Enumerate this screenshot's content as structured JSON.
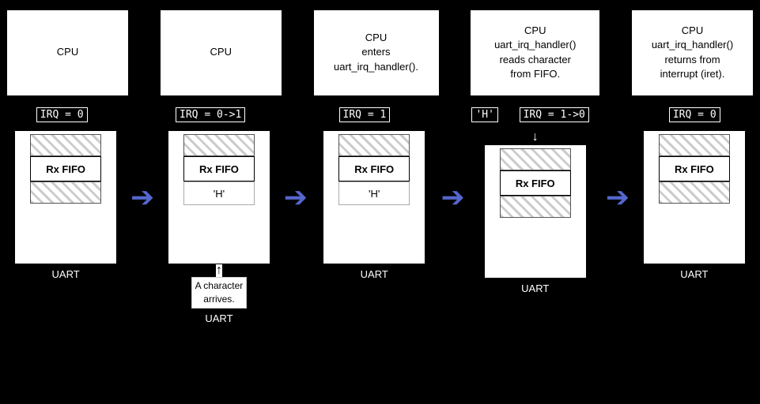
{
  "colors": {
    "background": "#000000",
    "box_bg": "#ffffff",
    "box_border": "#000000",
    "arrow_color": "#5566cc",
    "text_white": "#ffffff",
    "text_black": "#000000",
    "hatch_line": "#cccccc"
  },
  "cpu_boxes": [
    {
      "id": "cpu1",
      "text": "CPU"
    },
    {
      "id": "cpu2",
      "text": "CPU"
    },
    {
      "id": "cpu3",
      "text": "CPU\nenters\nuart_irq_handler()."
    },
    {
      "id": "cpu4",
      "text": "CPU\nuart_irq_handler()\nreads character\nfrom FIFO."
    },
    {
      "id": "cpu5",
      "text": "CPU\nuart_irq_handler()\nreturns from\ninterrupt (iret)."
    }
  ],
  "irq_labels": [
    {
      "id": "irq1",
      "text": "IRQ = 0"
    },
    {
      "id": "irq2",
      "text": "IRQ = 0->1"
    },
    {
      "id": "irq3",
      "text": "IRQ = 1"
    },
    {
      "id": "irq_h",
      "text": "'H'"
    },
    {
      "id": "irq4",
      "text": "IRQ = 1->0"
    },
    {
      "id": "irq5",
      "text": "IRQ = 0"
    }
  ],
  "uart_boxes": [
    {
      "id": "uart1",
      "show_char": false,
      "char": "",
      "label": "UART",
      "has_down_arrow": false,
      "down_arrow_pos": "above_char"
    },
    {
      "id": "uart2",
      "show_char": true,
      "char": "'H'",
      "label": "UART",
      "has_down_arrow": true,
      "down_arrow_pos": "above_char"
    },
    {
      "id": "uart3",
      "show_char": true,
      "char": "'H'",
      "label": "UART",
      "has_down_arrow": false,
      "down_arrow_pos": "above_char"
    },
    {
      "id": "uart4",
      "show_char": false,
      "char": "",
      "label": "UART",
      "has_down_arrow": true,
      "down_arrow_pos": "above_fifo",
      "fifo_arrow": true
    },
    {
      "id": "uart5",
      "show_char": false,
      "char": "",
      "label": "UART",
      "has_down_arrow": false,
      "down_arrow_pos": "above_char"
    }
  ],
  "arrows": [
    "→",
    "→",
    "→",
    "→"
  ],
  "annotation": {
    "text": "A character\narrives.",
    "position": "below_uart2"
  },
  "rx_fifo_label": "Rx FIFO"
}
